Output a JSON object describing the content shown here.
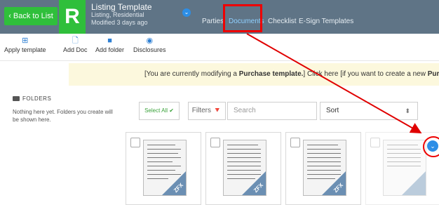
{
  "header": {
    "back_label": "‹  Back to List",
    "logo_letter": "R",
    "title": "Listing Template",
    "subtitle1": "Listing, Residential",
    "subtitle2": "Modified 3 days ago",
    "nav": [
      "Parties",
      "Documents",
      "Checklist",
      "E-Sign Templates"
    ],
    "active_nav": "Documents"
  },
  "toolbar": {
    "items": [
      {
        "label": "Apply template",
        "icon": "grid-icon"
      },
      {
        "label": "Add Doc",
        "icon": "add-doc-icon"
      },
      {
        "label": "Add folder",
        "icon": "add-folder-icon"
      },
      {
        "label": "Disclosures",
        "icon": "disclosures-icon"
      }
    ]
  },
  "banner": {
    "pre": "[You are currently modifying a ",
    "bold": "Purchase template.",
    "mid": "] Click here [if you want to create a new ",
    "bold2": "Purchase"
  },
  "folders": {
    "heading": "FOLDERS",
    "empty_text": "Nothing here yet. Folders you create will be shown here."
  },
  "filters": {
    "select_all": "Select All ✔",
    "filters_label": "Filters",
    "search_placeholder": "Search",
    "sort_value": "Sort"
  },
  "cards": [
    {
      "badge": "ZFX"
    },
    {
      "badge": "ZFX"
    },
    {
      "badge": "ZFX"
    },
    {
      "badge": ""
    }
  ],
  "colors": {
    "header_bg": "#5f7486",
    "accent_green": "#2fbf3b",
    "annotation_red": "#e00000",
    "banner_bg": "#fcf8dd",
    "link_blue": "#2d8ee6"
  }
}
